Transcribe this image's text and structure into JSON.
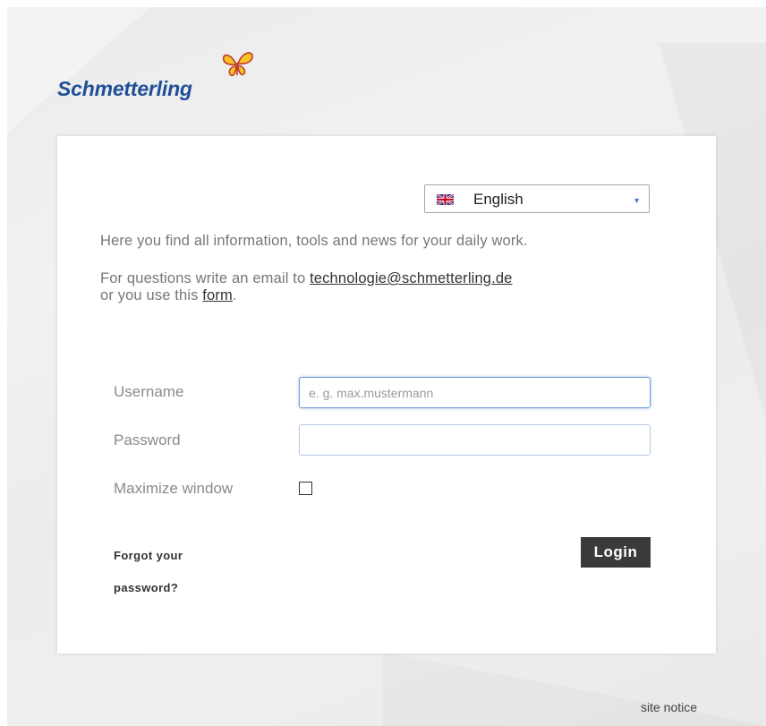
{
  "logo": {
    "text": "Schmetterling",
    "icon": "butterfly-icon",
    "text_color": "#1f4f97",
    "butterfly_color": "#f7c325"
  },
  "language": {
    "flag_icon": "uk-flag-icon",
    "selected": "English",
    "caret_icon": "chevron-down-icon"
  },
  "intro_text": "Here you find all information, tools and news for your daily work.",
  "contact": {
    "prefix": "For questions write an email to ",
    "email": "technologie@schmetterling.de",
    "middle": "or you use this ",
    "form_link": "form",
    "suffix": "."
  },
  "form": {
    "username_label": "Username",
    "username_placeholder": "e. g. max.mustermann",
    "username_value": "",
    "password_label": "Password",
    "password_value": "",
    "maximize_label": "Maximize window",
    "maximize_checked": false,
    "forgot_line1": "Forgot your",
    "forgot_line2": "password?",
    "login_label": "Login"
  },
  "footer": {
    "site_notice": "site notice"
  },
  "colors": {
    "login_button": "#3a3a3a",
    "focus_border": "#6f9bd8"
  }
}
